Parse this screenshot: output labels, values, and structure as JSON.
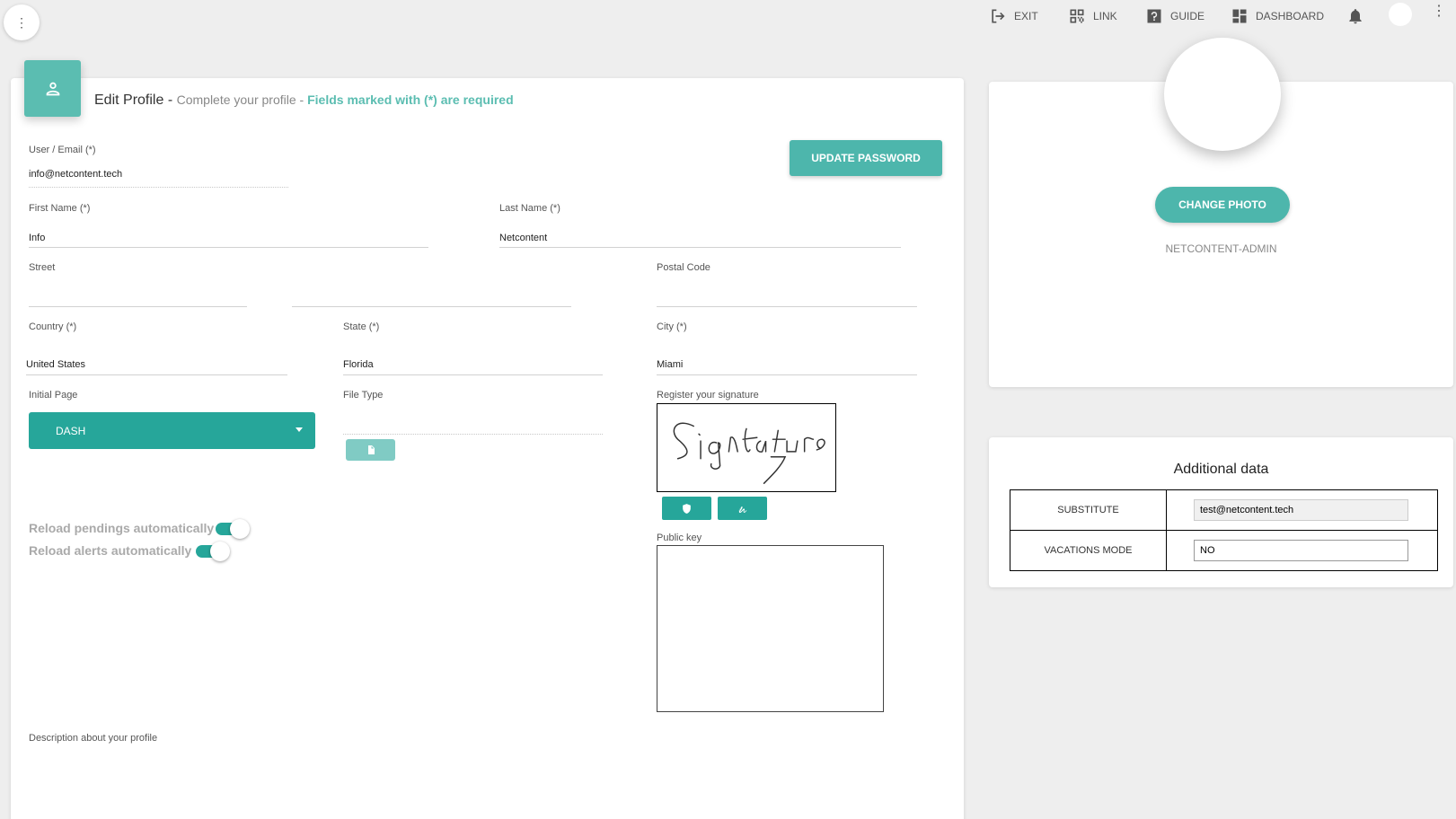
{
  "topnav": {
    "exit_label": "EXIT",
    "link_label": "LINK",
    "guide_label": "GUIDE",
    "dashboard_label": "DASHBOARD"
  },
  "form": {
    "title": "Edit Profile",
    "title_sep": " - ",
    "subtitle": "Complete your profile",
    "subtitle_sep": " - ",
    "required_note": "Fields marked with (*) are required",
    "update_password_label": "UPDATE PASSWORD",
    "email": {
      "label": "User / Email (*)",
      "value": "info@netcontent.tech"
    },
    "first_name": {
      "label": "First Name (*)",
      "value": "Info"
    },
    "last_name": {
      "label": "Last Name (*)",
      "value": "Netcontent"
    },
    "street": {
      "label": "Street",
      "value": ""
    },
    "postal_code": {
      "label": "Postal Code",
      "value": ""
    },
    "country": {
      "label": "Country (*)",
      "value": "United States"
    },
    "state": {
      "label": "State (*)",
      "value": "Florida"
    },
    "city": {
      "label": "City (*)",
      "value": "Miami"
    },
    "initial_page": {
      "label": "Initial Page",
      "value": "DASH"
    },
    "file_type": {
      "label": "File Type",
      "value": ""
    },
    "signature": {
      "label": "Register your signature",
      "text": "Signature"
    },
    "public_key": {
      "label": "Public key",
      "value": ""
    },
    "reload_pendings": {
      "label": "Reload pendings automatically",
      "enabled": true
    },
    "reload_alerts": {
      "label": "Reload alerts automatically",
      "enabled": true
    },
    "description": {
      "label": "Description about your profile"
    }
  },
  "profile": {
    "change_photo_label": "CHANGE PHOTO",
    "username": "NETCONTENT-ADMIN"
  },
  "additional": {
    "title": "Additional data",
    "rows": [
      {
        "key": "SUBSTITUTE",
        "value": "test@netcontent.tech"
      },
      {
        "key": "VACATIONS MODE",
        "value": "NO"
      }
    ]
  },
  "colors": {
    "accent": "#4db6ac",
    "accent_dark": "#26a69a"
  }
}
